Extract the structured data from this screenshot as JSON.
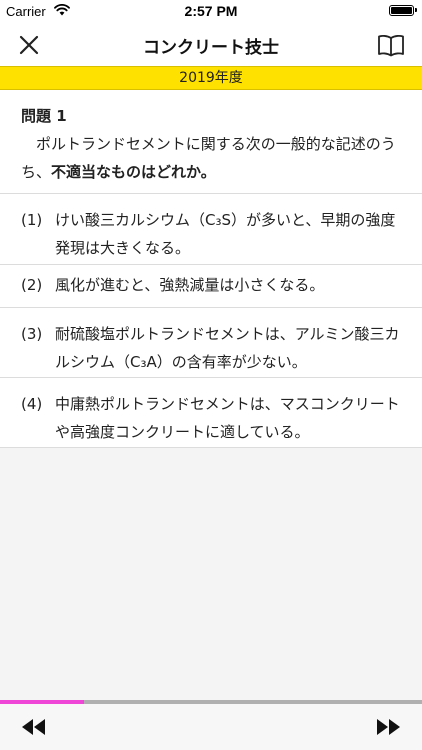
{
  "status_bar": {
    "carrier": "Carrier",
    "time": "2:57 PM"
  },
  "nav": {
    "title": "コンクリート技士",
    "close_icon": "close-icon",
    "book_icon": "book-icon"
  },
  "year_banner": "2019年度",
  "question": {
    "number": "問題 1",
    "text_lead": "ポルトランドセメントに関する次の一般的な記述のうち、",
    "text_emphasis": "不適当なものはどれか。"
  },
  "options": [
    {
      "num": "(1)",
      "text": "けい酸三カルシウム（C₃S）が多いと、早期の強度発現は大きくなる。"
    },
    {
      "num": "(2)",
      "text": "風化が進むと、強熱減量は小さくなる。"
    },
    {
      "num": "(3)",
      "text": "耐硫酸塩ポルトランドセメントは、アルミン酸三カルシウム（C₃A）の含有率が少ない。"
    },
    {
      "num": "(4)",
      "text": "中庸熱ポルトランドセメントは、マスコンクリートや高強度コンクリートに適している。"
    }
  ],
  "progress": {
    "fraction": 0.2,
    "fill_color": "#f046d8"
  },
  "colors": {
    "banner": "#ffe100"
  },
  "bottom": {
    "rewind_icon": "rewind-icon",
    "forward_icon": "fast-forward-icon"
  }
}
